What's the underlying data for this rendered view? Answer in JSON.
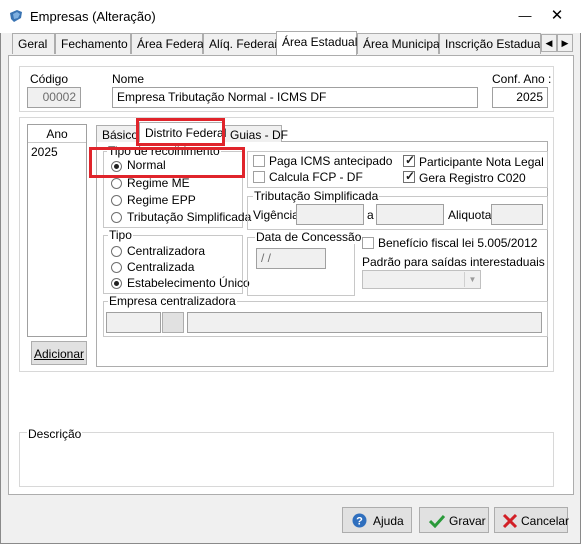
{
  "window": {
    "title": "Empresas (Alteração)"
  },
  "main_tabs": [
    {
      "label": "Geral"
    },
    {
      "label": "Fechamento"
    },
    {
      "label": "Área Federal"
    },
    {
      "label": "Alíq. Federais"
    },
    {
      "label": "Área Estadual"
    },
    {
      "label": "Área Municipal"
    },
    {
      "label": "Inscrição Estadual S"
    }
  ],
  "header": {
    "codigo_label": "Código",
    "codigo_value": "00002",
    "nome_label": "Nome",
    "nome_value": "Empresa Tributação Normal - ICMS DF",
    "conf_ano_label": "Conf. Ano :",
    "conf_ano_value": "2025"
  },
  "ano_list": {
    "header": "Ano",
    "items": [
      "2025"
    ],
    "add_button": "Adicionar"
  },
  "sub_tabs": [
    {
      "label": "Básico"
    },
    {
      "label": "Distrito Federal"
    },
    {
      "label": "Guias - DF"
    }
  ],
  "tipo_recolhimento": {
    "legend": "Tipo de recolhimento",
    "options": [
      "Normal",
      "Regime ME",
      "Regime EPP",
      "Tributação Simplificada"
    ],
    "selected": "Normal"
  },
  "tipo": {
    "legend": "Tipo",
    "options": [
      "Centralizadora",
      "Centralizada",
      "Estabelecimento Único"
    ],
    "selected": "Estabelecimento Único"
  },
  "checkboxes": {
    "paga_icms": {
      "label": "Paga ICMS antecipado",
      "checked": false
    },
    "calcula_fcp": {
      "label": "Calcula FCP - DF",
      "checked": false
    },
    "participante": {
      "label": "Participante Nota Legal",
      "checked": true
    },
    "gera_registro": {
      "label": "Gera Registro C020",
      "checked": true
    }
  },
  "tributacao_simplificada": {
    "legend": "Tributação Simplificada",
    "vigencia_label": "Vigência",
    "a_label": "a",
    "aliquota_label": "Aliquota"
  },
  "data_concessao": {
    "legend": "Data de Concessão",
    "value": " / /"
  },
  "beneficio": {
    "label": "Benefício fiscal lei 5.005/2012",
    "checked": false
  },
  "padrao_saidas": {
    "label": "Padrão para saídas interestaduais"
  },
  "empresa_centralizadora": {
    "legend": "Empresa centralizadora"
  },
  "descricao": {
    "legend": "Descrição"
  },
  "footer": {
    "ajuda": "Ajuda",
    "gravar": "Gravar",
    "cancelar": "Cancelar"
  },
  "colors": {
    "highlight": "#e0242b",
    "accent": "#0b5fb3"
  }
}
